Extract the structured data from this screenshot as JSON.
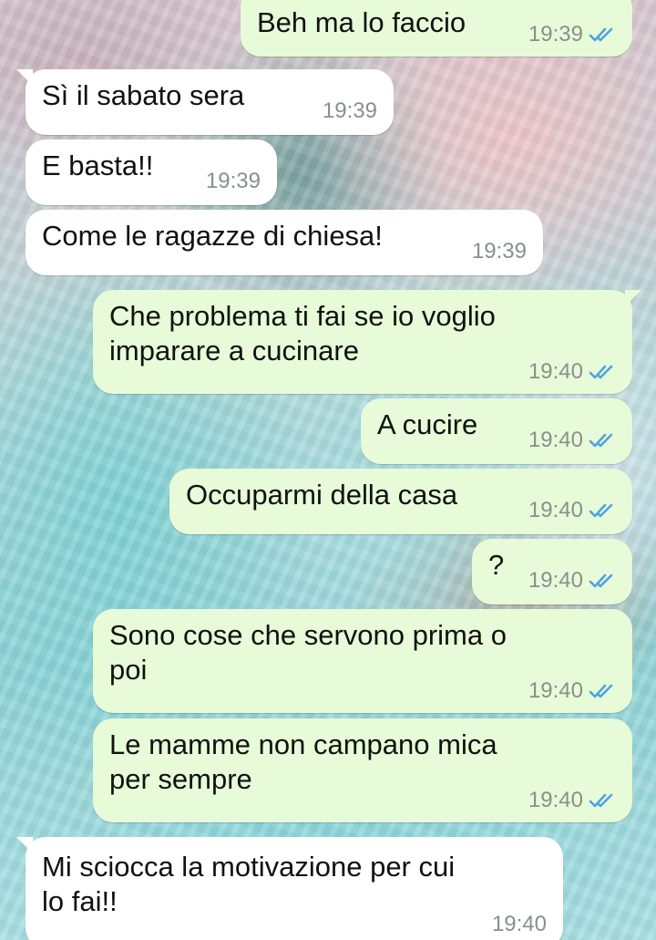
{
  "chat": {
    "messages": [
      {
        "dir": "out",
        "text": "Beh ma lo faccio",
        "time": "19:39",
        "status_icon": "double-check-icon"
      },
      {
        "dir": "in",
        "text": "Sì il sabato sera",
        "time": "19:39"
      },
      {
        "dir": "in",
        "text": "E basta!!",
        "time": "19:39"
      },
      {
        "dir": "in",
        "text": "Come le ragazze di chiesa!",
        "time": "19:39"
      },
      {
        "dir": "out",
        "text": "Che problema ti fai se io voglio\nimparare a cucinare",
        "time": "19:40",
        "status_icon": "double-check-icon"
      },
      {
        "dir": "out",
        "text": "A cucire",
        "time": "19:40",
        "status_icon": "double-check-icon"
      },
      {
        "dir": "out",
        "text": "Occuparmi della casa",
        "time": "19:40",
        "status_icon": "double-check-icon"
      },
      {
        "dir": "out",
        "text": "?",
        "time": "19:40",
        "status_icon": "double-check-icon"
      },
      {
        "dir": "out",
        "text": "Sono cose che servono prima o\npoi",
        "time": "19:40",
        "status_icon": "double-check-icon"
      },
      {
        "dir": "out",
        "text": "Le mamme non campano mica\nper sempre",
        "time": "19:40",
        "status_icon": "double-check-icon"
      },
      {
        "dir": "in",
        "text": "Mi sciocca la motivazione per cui\nlo fai!!",
        "time": "19:40"
      }
    ]
  },
  "colors": {
    "bubble_out": "#e7fbd8",
    "bubble_in": "#ffffff",
    "read_ticks": "#4fa3e0",
    "meta_text": "#8a8f8c"
  }
}
